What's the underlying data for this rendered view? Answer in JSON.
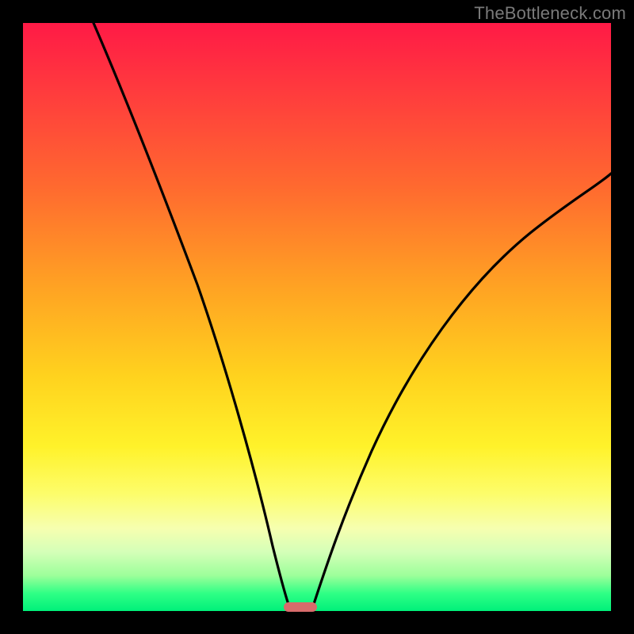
{
  "watermark": "TheBottleneck.com",
  "colors": {
    "frame": "#000000",
    "curve": "#000000",
    "marker": "#d86b6b",
    "gradient_top": "#ff1a46",
    "gradient_bottom": "#00f07a"
  },
  "chart_data": {
    "type": "line",
    "title": "",
    "xlabel": "",
    "ylabel": "",
    "xlim": [
      0,
      100
    ],
    "ylim": [
      0,
      100
    ],
    "grid": false,
    "legend": false,
    "annotations": [],
    "series": [
      {
        "name": "left-branch",
        "x": [
          12,
          16,
          20,
          24,
          28,
          32,
          36,
          40,
          42,
          44,
          45.5
        ],
        "y": [
          100,
          90,
          79,
          67,
          55,
          43,
          31,
          18,
          10,
          3,
          0
        ]
      },
      {
        "name": "right-branch",
        "x": [
          49,
          52,
          56,
          62,
          70,
          80,
          90,
          100
        ],
        "y": [
          0,
          6,
          15,
          28,
          44,
          58,
          68,
          75
        ]
      }
    ],
    "marker": {
      "x_center": 47,
      "x_width": 5,
      "y": 0
    }
  }
}
